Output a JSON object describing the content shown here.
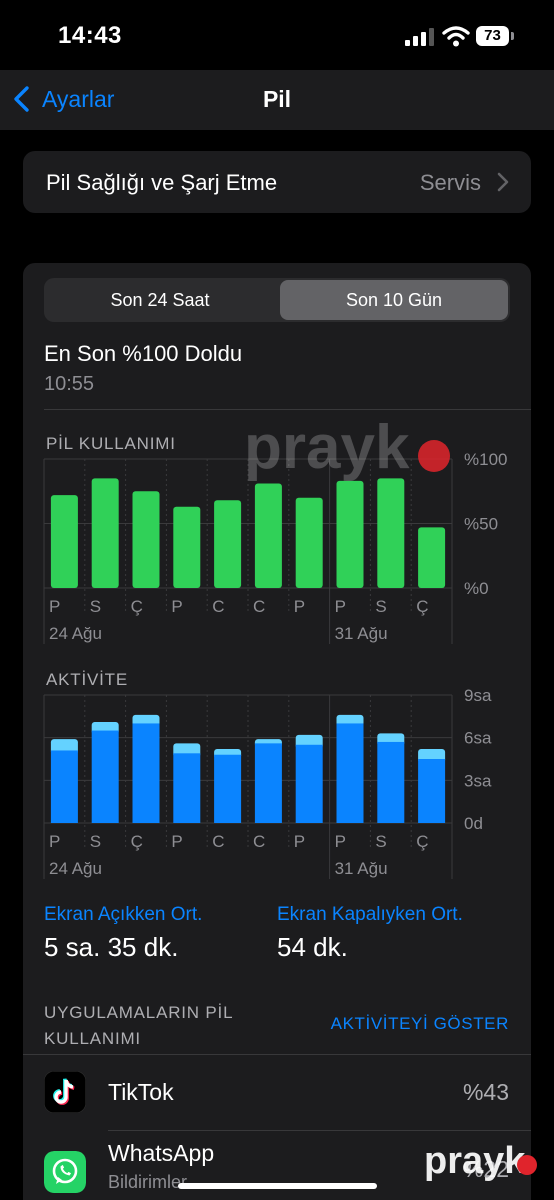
{
  "status": {
    "time": "14:43",
    "battery": "73"
  },
  "nav": {
    "back_label": "Ayarlar",
    "title": "Pil"
  },
  "health_row": {
    "label": "Pil Sağlığı ve Şarj Etme",
    "value": "Servis"
  },
  "segments": {
    "tab1": "Son 24 Saat",
    "tab2": "Son 10 Gün",
    "selected": "Son 10 Gün"
  },
  "last_charged": {
    "title": "En Son %100 Doldu",
    "time": "10:55"
  },
  "battery_section_label": "PİL KULLANIMI",
  "activity_section_label": "AKTİVİTE",
  "chart_data": [
    {
      "type": "bar",
      "title": "PİL KULLANIMI",
      "categories": [
        "P",
        "S",
        "Ç",
        "P",
        "C",
        "C",
        "P",
        "P",
        "S",
        "Ç"
      ],
      "date_labels": [
        "24 Ağu",
        "31 Ağu"
      ],
      "series": [
        {
          "values": [
            72,
            85,
            75,
            63,
            68,
            81,
            70,
            83,
            85,
            47
          ]
        }
      ],
      "yticks": [
        "%100",
        "%50",
        "%0"
      ],
      "ylim": [
        0,
        100
      ],
      "color": "#30d158",
      "grid": true
    },
    {
      "type": "bar",
      "title": "AKTİVİTE",
      "categories": [
        "P",
        "S",
        "Ç",
        "P",
        "C",
        "C",
        "P",
        "P",
        "S",
        "Ç"
      ],
      "date_labels": [
        "24 Ağu",
        "31 Ağu"
      ],
      "series": [
        {
          "values": [
            5.1,
            6.5,
            7.0,
            4.9,
            4.8,
            5.6,
            5.5,
            7.0,
            5.7,
            4.5
          ]
        },
        {
          "values": [
            0.8,
            0.6,
            0.6,
            0.7,
            0.4,
            0.3,
            0.7,
            0.6,
            0.6,
            0.7
          ]
        }
      ],
      "yticks": [
        "9sa",
        "6sa",
        "3sa",
        "0d"
      ],
      "ylim": [
        0,
        9
      ],
      "colors": [
        "#0a84ff",
        "#64d2ff"
      ],
      "grid": true
    }
  ],
  "screen_on": {
    "label": "Ekran Açıkken Ort.",
    "value": "5 sa. 35 dk."
  },
  "screen_off": {
    "label": "Ekran Kapalıyken Ort.",
    "value": "54 dk."
  },
  "apps_section": {
    "label": "UYGULAMALARIN PİL KULLANIMI",
    "action": "AKTİVİTEYİ GÖSTER"
  },
  "apps": [
    {
      "name": "TikTok",
      "subtitle": "",
      "percent": "%43",
      "icon": "tiktok-icon"
    },
    {
      "name": "WhatsApp",
      "subtitle": "Bildirimler",
      "percent": "%22",
      "icon": "whatsapp-icon"
    }
  ],
  "watermark": "prayk",
  "colors": {
    "accent": "#0a84ff",
    "green": "#30d158",
    "light_blue": "#64d2ff",
    "card": "#1c1c1e"
  }
}
